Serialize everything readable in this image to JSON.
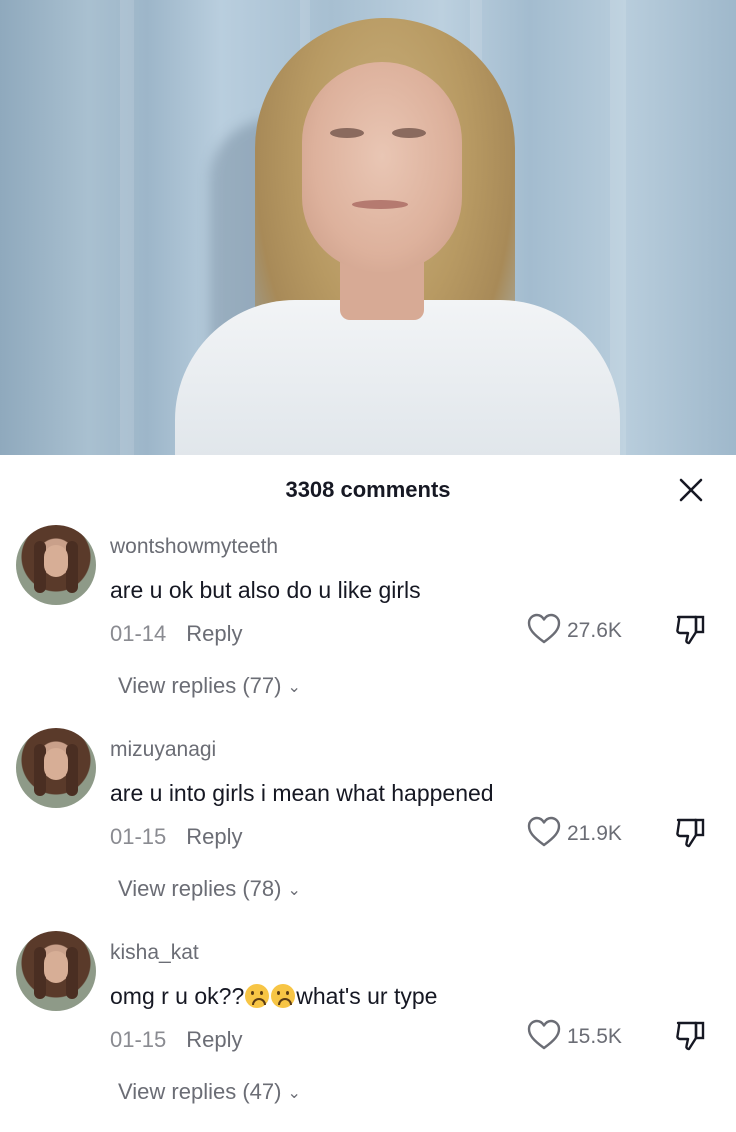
{
  "header": {
    "title": "3308 comments"
  },
  "comments": [
    {
      "username": "wontshowmyteeth",
      "text": "are u ok but also do u like girls",
      "date": "01-14",
      "reply_label": "Reply",
      "likes": "27.6K",
      "view_replies": "View replies (77)"
    },
    {
      "username": "mizuyanagi",
      "text": "are u into girls i mean what happened",
      "date": "01-15",
      "reply_label": "Reply",
      "likes": "21.9K",
      "view_replies": "View replies (78)"
    },
    {
      "username": "kisha_kat",
      "text_before": "omg r u ok??",
      "text_after": "what's ur type",
      "emoji": [
        "sad-face-emoji",
        "sad-face-emoji"
      ],
      "date": "01-15",
      "reply_label": "Reply",
      "likes": "15.5K",
      "view_replies": "View replies (47)"
    }
  ],
  "icons": {
    "close": "close-icon",
    "like": "heart-outline-icon",
    "dislike": "thumbs-down-icon",
    "expand": "chevron-down-icon"
  },
  "colors": {
    "text": "#161823",
    "secondary": "#8a8b91",
    "background": "#ffffff"
  }
}
